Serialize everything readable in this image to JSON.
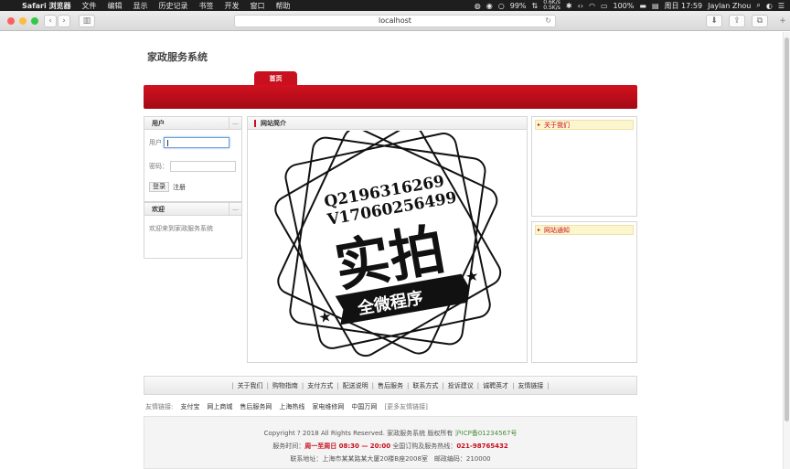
{
  "menubar": {
    "apple": "",
    "items": [
      "Safari 浏览器",
      "文件",
      "编辑",
      "显示",
      "历史记录",
      "书签",
      "开发",
      "窗口",
      "帮助"
    ],
    "battery": "99%",
    "net_up": "0.6K/s",
    "net_down": "0.5K/s",
    "battery2": "100%",
    "clock": "周日 17:59",
    "user": "Jaylan Zhou"
  },
  "browser": {
    "url": "localhost"
  },
  "site": {
    "title": "家政服务系统",
    "nav_home": "首页"
  },
  "login": {
    "title": "用户",
    "user_label": "用户",
    "pass_label": "密码：",
    "login_btn": "登录",
    "register": "注册"
  },
  "welcome": {
    "title": "欢迎",
    "text": "欢迎来到家政服务系统"
  },
  "intro": {
    "title": "网站简介",
    "image_lines": [
      "Q2196316269",
      "V17060256499",
      "实拍",
      "全微程序"
    ]
  },
  "about": {
    "title": "关于我们"
  },
  "notice": {
    "title": "网站通知"
  },
  "footer_links": [
    "关于我们",
    "购物指南",
    "支付方式",
    "配送说明",
    "售后服务",
    "联系方式",
    "投诉建议",
    "诚聘英才",
    "友情链接"
  ],
  "friends": {
    "label": "友情链接:",
    "links": [
      "支付宝",
      "网上商城",
      "售后服务网",
      "上海热线",
      "家电维修网",
      "中国万网"
    ],
    "more": "[更多友情链接]"
  },
  "copyright": {
    "line1": "Copyright ? 2018 All Rights Reserved. 家政服务系统 版权所有",
    "icp": "沪ICP备01234567号",
    "hours_label": "服务时间：",
    "hours": "周一至周日 08:30 — 20:00",
    "hotline_label": "全国订购及服务热线：",
    "hotline": "021-98765432",
    "address": "联系地址：上海市某某路某大厦20楼B座2008室　邮政编码：210000"
  }
}
